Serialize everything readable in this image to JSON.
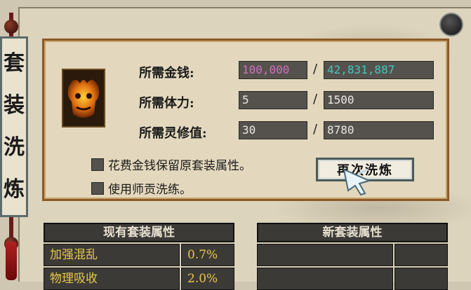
{
  "banner": {
    "chars": [
      "套",
      "装",
      "洗",
      "炼"
    ]
  },
  "cost": {
    "money_label": "所需金钱:",
    "money_required": "100,000",
    "money_have": "42,831,887",
    "stamina_label": "所需体力:",
    "stamina_required": "5",
    "stamina_have": "1500",
    "spirit_label": "所需灵修值:",
    "spirit_required": "30",
    "spirit_have": "8780",
    "separator": "/"
  },
  "options": {
    "keep_attr_label": "花费金钱保留原套装属性。",
    "use_tribute_label": "使用师贡洗练。"
  },
  "actions": {
    "rewash_label": "再次洗炼"
  },
  "current_attrs": {
    "header": "现有套装属性",
    "rows": [
      {
        "name": "加强混乱",
        "value": "0.7%"
      },
      {
        "name": "物理吸收",
        "value": "2.0%"
      }
    ]
  },
  "new_attrs": {
    "header": "新套装属性"
  },
  "colors": {
    "money_required": "#d070c0",
    "money_have": "#40c8c0",
    "attr_text": "#e8c84a",
    "frame": "#8b5a2b"
  },
  "icons": {
    "set_icon": "demon-mask-icon",
    "close": "circle-close-icon",
    "cursor": "pointer-cursor-icon"
  }
}
